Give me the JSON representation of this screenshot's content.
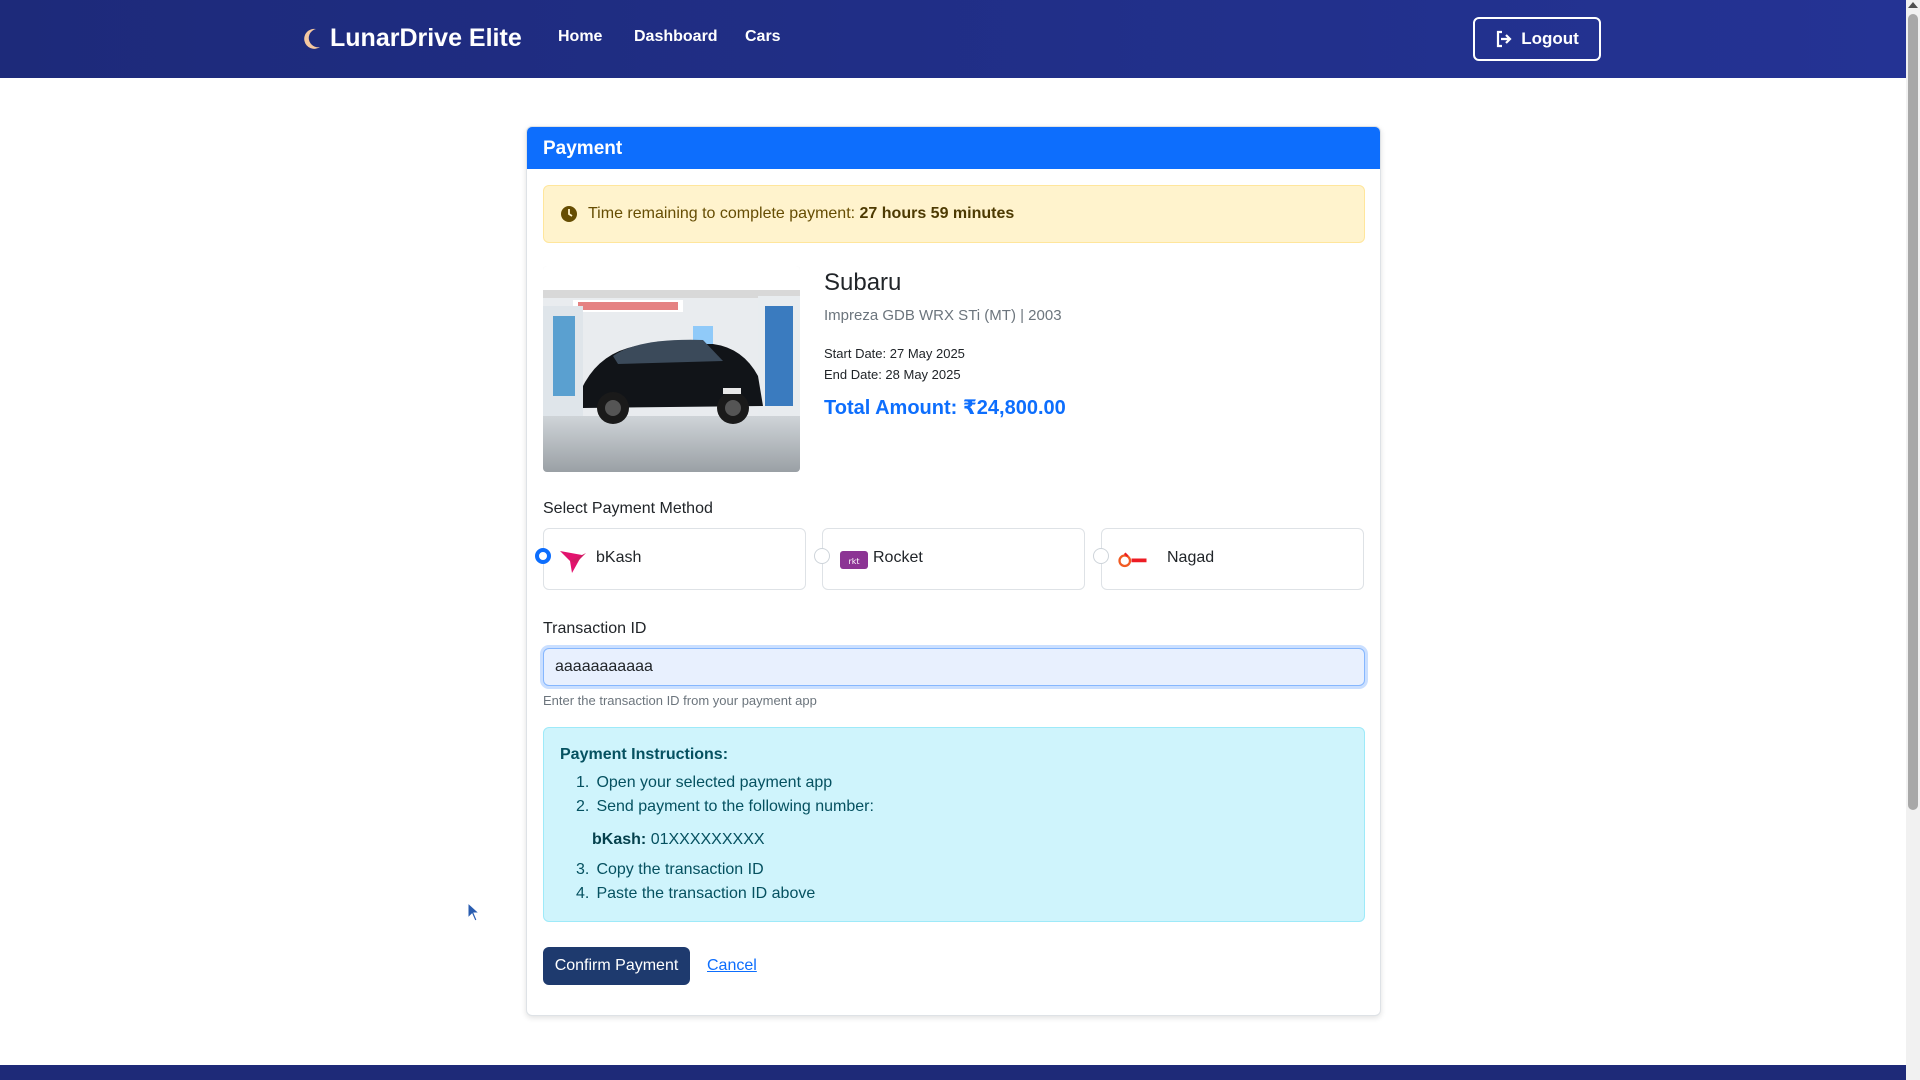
{
  "navbar": {
    "brand": "LunarDrive Elite",
    "links": [
      "Home",
      "Dashboard",
      "Cars"
    ],
    "logout_label": "Logout",
    "bg_color": "#243394"
  },
  "payment": {
    "header": "Payment",
    "timer": {
      "prefix": "Time remaining to complete payment:",
      "value": "27 hours 59 minutes"
    },
    "car": {
      "title": "Subaru",
      "subtitle": "Impreza GDB WRX STi (MT) | 2003",
      "start_date": "Start Date: 27 May 2025",
      "end_date": "End Date: 28 May 2025",
      "total": "Total Amount: ₹24,800.00"
    },
    "method_label": "Select Payment Method",
    "methods": [
      {
        "name": "bKash",
        "icon": "bkash-icon",
        "selected": true
      },
      {
        "name": "Rocket",
        "icon": "rocket-icon",
        "selected": false
      },
      {
        "name": "Nagad",
        "icon": "nagad-icon",
        "selected": false
      }
    ],
    "txn_label": "Transaction ID",
    "txn_value": "aaaaaaaaaaa",
    "txn_help": "Enter the transaction ID from your payment app",
    "instructions": {
      "title": "Payment Instructions:",
      "steps": [
        {
          "num": "1.",
          "text": "Open your selected payment app"
        },
        {
          "num": "2.",
          "text": "Send payment to the following number:"
        },
        {
          "num": "3.",
          "text": "Copy the transaction ID"
        },
        {
          "num": "4.",
          "text": "Paste the transaction ID above"
        }
      ],
      "number_label": "bKash:",
      "number_value": "01XXXXXXXXX"
    },
    "confirm_label": "Confirm Payment",
    "cancel_label": "Cancel",
    "accent_color": "#0d6efd"
  }
}
